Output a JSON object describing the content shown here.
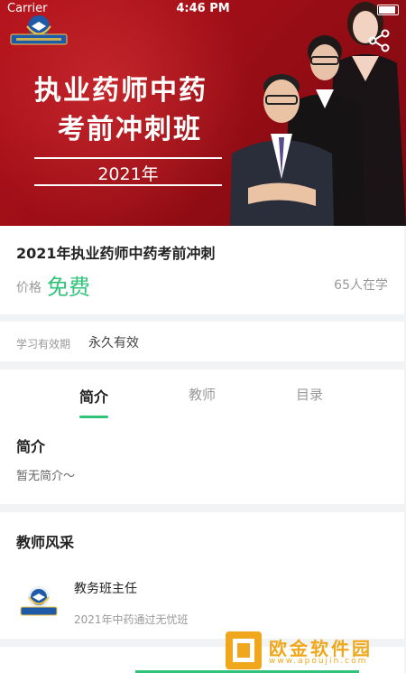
{
  "status_bar": {
    "carrier": "Carrier",
    "time": "4:46 PM"
  },
  "banner": {
    "title_line1": "执业药师中药",
    "title_line2": "考前冲刺班",
    "year": "2021年",
    "background_color": "#b3121b",
    "share_icon": "share-icon"
  },
  "course": {
    "title": "2021年执业药师中药考前冲刺",
    "price_label": "价格",
    "price_value": "免费",
    "learners": "65人在学",
    "validity_label": "学习有效期",
    "validity_value": "永久有效"
  },
  "tabs": [
    {
      "label": "简介",
      "active": true
    },
    {
      "label": "教师",
      "active": false
    },
    {
      "label": "目录",
      "active": false
    }
  ],
  "intro": {
    "heading": "简介",
    "text": "暂无简介～"
  },
  "teachers": {
    "heading": "教师风采",
    "items": [
      {
        "name": "教务班主任",
        "desc": "2021年中药通过无忧班"
      }
    ]
  },
  "progress": {
    "fraction": 0.55
  },
  "watermark": {
    "text": "欧金软件园",
    "url": "www.apoujin.com"
  },
  "colors": {
    "accent": "#2fc37a",
    "banner": "#b3121b",
    "watermark": "#f0a71b"
  }
}
